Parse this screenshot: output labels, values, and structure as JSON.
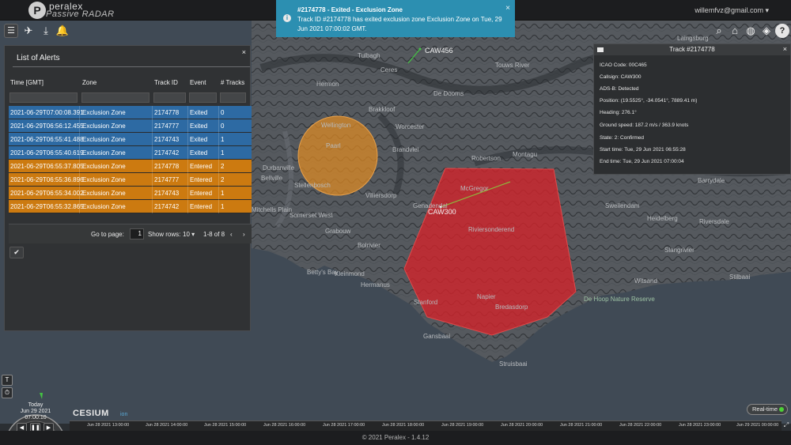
{
  "header": {
    "logo_letter": "P",
    "brand_top": "peralex",
    "brand_bottom": "Passive RADAR",
    "user_email": "willemfvz@gmail.com"
  },
  "toolbar_left": [
    "menu-icon",
    "airplane-icon",
    "download-icon",
    "bell-icon"
  ],
  "toolbar_right": [
    "search-icon",
    "home-icon",
    "globe-icon",
    "layers-icon",
    "help-icon"
  ],
  "notification": {
    "title": "#2174778 - Exited - Exclusion Zone",
    "body": "Track ID #2174778 has exited exclusion zone Exclusion Zone on Tue, 29 Jun 2021 07:00:02 GMT.",
    "close": "×",
    "icon": "info-icon",
    "color": "#2c8fb1"
  },
  "alerts_panel": {
    "title": "List of Alerts",
    "close": "×",
    "columns": [
      "Time [GMT]",
      "Zone",
      "Track ID",
      "Event",
      "# Tracks"
    ],
    "rows": [
      {
        "time": "2021-06-29T07:00:08.391",
        "zone": "Exclusion Zone",
        "track_id": "2174778",
        "event": "Exited",
        "tracks": "0"
      },
      {
        "time": "2021-06-29T06:56:12.455",
        "zone": "Exclusion Zone",
        "track_id": "2174777",
        "event": "Exited",
        "tracks": "0"
      },
      {
        "time": "2021-06-29T06:55:41.488",
        "zone": "Exclusion Zone",
        "track_id": "2174743",
        "event": "Exited",
        "tracks": "1"
      },
      {
        "time": "2021-06-29T06:55:40.619",
        "zone": "Exclusion Zone",
        "track_id": "2174742",
        "event": "Exited",
        "tracks": "1"
      },
      {
        "time": "2021-06-29T06:55:37.805",
        "zone": "Exclusion Zone",
        "track_id": "2174778",
        "event": "Entered",
        "tracks": "2"
      },
      {
        "time": "2021-06-29T06:55:36.896",
        "zone": "Exclusion Zone",
        "track_id": "2174777",
        "event": "Entered",
        "tracks": "2"
      },
      {
        "time": "2021-06-29T06:55:34.002",
        "zone": "Exclusion Zone",
        "track_id": "2174743",
        "event": "Entered",
        "tracks": "1"
      },
      {
        "time": "2021-06-29T06:55:32.865",
        "zone": "Exclusion Zone",
        "track_id": "2174742",
        "event": "Entered",
        "tracks": "1"
      }
    ],
    "colors": {
      "exited": "#2d6aa3",
      "entered": "#cc7a10"
    },
    "pager": {
      "goto_label": "Go to page:",
      "page": "1",
      "rows_label": "Show rows:",
      "rows_value": "10",
      "range": "1-8 of 8",
      "prev": "‹",
      "next": "›"
    },
    "confirm": "✔"
  },
  "track_panel": {
    "title": "Track #2174778",
    "close": "×",
    "lines": [
      "ICAO Code: 00C465",
      "Callsign: CAW300",
      "ADS-B: Detected",
      "Position: (19.5525°, -34.0541°, 7889.41 m)",
      "Heading: 276.1°",
      "Ground speed: 187.2 m/s / 363.9 knots",
      "State: 2: Confirmed",
      "Start time: Tue, 29 Jun 2021 06:55:28",
      "End time: Tue, 29 Jun 2021 07:00:04"
    ]
  },
  "map": {
    "callsigns": [
      "CAW456",
      "CAW300"
    ],
    "labels": [
      "Laingsburg",
      "Tulbagh",
      "Ceres",
      "Touws River",
      "Hermon",
      "De Doorns",
      "Brakkloof",
      "Worcester",
      "Wellington",
      "Paarl",
      "Brandvlei",
      "Robertson",
      "Montagu",
      "Barrydale",
      "Durbanville",
      "Bellville",
      "Stellenbosch",
      "Villiersdorp",
      "Mitchells Plain",
      "Somerset West",
      "Grabouw",
      "Genadendal",
      "McGregor",
      "Swellendam",
      "Heidelberg",
      "Riversdale",
      "Bredasdorp",
      "Napier",
      "Stanford",
      "Hermanus",
      "Kleinmond",
      "Betty's Bay",
      "Gansbaai",
      "Struisbaai",
      "Witsand",
      "Stilbaai",
      "De Hoop Nature Reserve",
      "Riviersonderend",
      "Bolrivier",
      "Slangrivier"
    ],
    "zone_colors": {
      "circle": "#e08a22",
      "polygon": "#d6232a"
    }
  },
  "clock": {
    "today": "Today",
    "date": "Jun 29 2021",
    "time": "07:00:10",
    "buttons": [
      "◀",
      "❚❚",
      "▶"
    ]
  },
  "side_buttons": [
    "T",
    "⏱"
  ],
  "cesium": {
    "name": "CESIUM",
    "suffix": "ion"
  },
  "realtime_label": "Real-time",
  "timeline": [
    "Jun 28 2021 13:00:00",
    "Jun 28 2021 14:00:00",
    "Jun 28 2021 15:00:00",
    "Jun 28 2021 16:00:00",
    "Jun 28 2021 17:00:00",
    "Jun 28 2021 18:00:00",
    "Jun 28 2021 19:00:00",
    "Jun 28 2021 20:00:00",
    "Jun 28 2021 21:00:00",
    "Jun 28 2021 22:00:00",
    "Jun 28 2021 23:00:00",
    "Jun 29 2021 00:00:00"
  ],
  "footer": "© 2021 Peralex - 1.4.12"
}
